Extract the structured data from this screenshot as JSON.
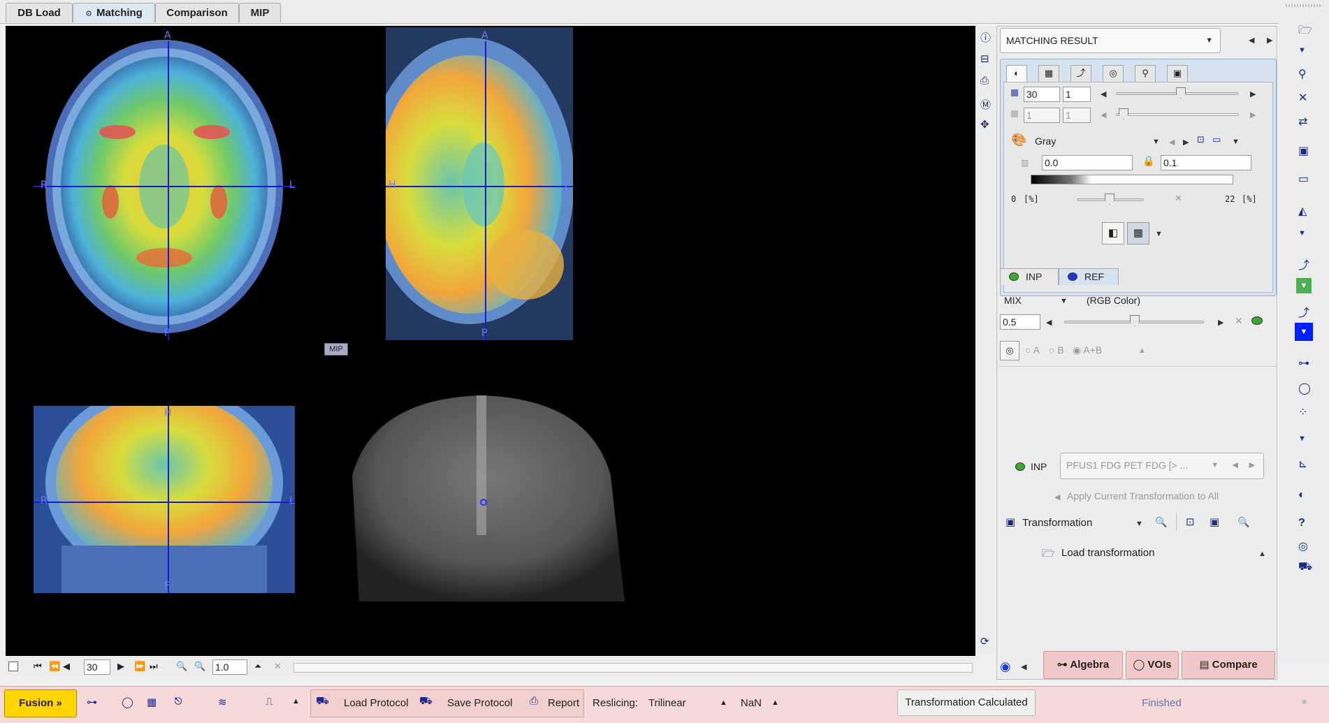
{
  "tabs": [
    {
      "label": "DB Load",
      "active": false
    },
    {
      "label": "Matching",
      "active": true,
      "icon": "gear-icon"
    },
    {
      "label": "Comparison",
      "active": false
    },
    {
      "label": "MIP",
      "active": false
    }
  ],
  "viewer": {
    "axial_labels": {
      "top": "A",
      "bottom": "P",
      "left": "R",
      "right": "L"
    },
    "sagittal_labels": {
      "top": "A",
      "bottom": "P",
      "left": "H",
      "right": "F"
    },
    "coronal_labels": {
      "top": "H",
      "bottom": "F",
      "left": "R",
      "right": "L"
    },
    "mip_badge": "MIP",
    "slice_value": "30",
    "zoom_value": "1.0"
  },
  "right_panel": {
    "title_combo": "MATCHING RESULT",
    "slice_a": "30",
    "slice_b": "1",
    "slice_c": "1",
    "slice_d": "1",
    "colormap": "Gray",
    "range_min": "0.0",
    "range_max": "0.1",
    "pct_min": "0",
    "pct_unit": "[%]",
    "pct_max": "22",
    "inp_tab": "INP",
    "ref_tab": "REF",
    "mix_label": "MIX",
    "mix_mode": "(RGB Color)",
    "mix_value": "0.5",
    "radio_a": "A",
    "radio_b": "B",
    "radio_ab": "A+B",
    "inp_label": "INP",
    "inp_series": "PFUS1 FDG PET FDG [> ...",
    "apply_all": "Apply Current Transformation to All",
    "transformation": "Transformation",
    "load_transformation": "Load transformation",
    "algebra": "Algebra",
    "vois": "VOIs",
    "compare": "Compare"
  },
  "statusbar": {
    "fusion": "Fusion »",
    "load_protocol": "Load Protocol",
    "save_protocol": "Save Protocol",
    "report": "Report",
    "reslicing_label": "Reslicing:",
    "reslicing_value": "Trilinear",
    "nan": "NaN",
    "transformation_status": "Transformation Calculated",
    "finished": "Finished"
  },
  "colors": {
    "accent": "#1a1acc",
    "fusion_button": "#ffd400",
    "status_bg": "#f5d9d9",
    "panel_bg": "#ececec"
  }
}
